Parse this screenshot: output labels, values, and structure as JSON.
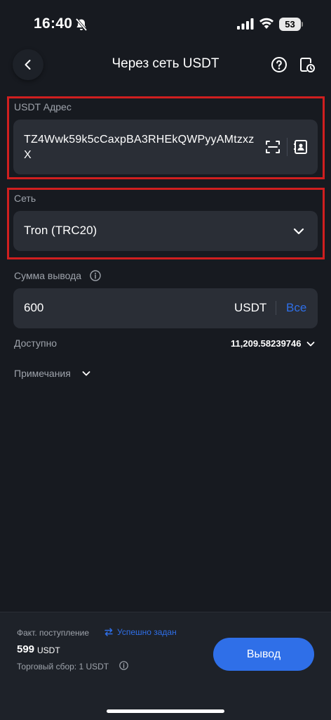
{
  "status_bar": {
    "time": "16:40",
    "battery": "53"
  },
  "header": {
    "title": "Через сеть USDT"
  },
  "address": {
    "label": "USDT Адрес",
    "value": "TZ4Wwk59k5cCaxpBA3RHEkQWPyyAMtzxzX"
  },
  "network": {
    "label": "Сеть",
    "value": "Tron (TRC20)"
  },
  "amount": {
    "label": "Сумма вывода",
    "value": "600",
    "unit": "USDT",
    "all_label": "Все"
  },
  "available": {
    "label": "Доступно",
    "value": "11,209.58239746"
  },
  "notes": {
    "label": "Примечания"
  },
  "footer": {
    "fact_label": "Факт. поступление",
    "success_label": "Успешно задан",
    "received_value": "599",
    "received_unit": "USDT",
    "fee_label": "Торговый сбор: 1 USDT",
    "submit_label": "Вывод"
  },
  "colors": {
    "accent": "#2f6fe8",
    "highlight": "#d01f1f",
    "background": "#171a20",
    "field": "#2a2e36"
  },
  "icons": [
    "bell-off-icon",
    "signal-icon",
    "wifi-icon",
    "battery-icon",
    "back-arrow-icon",
    "help-icon",
    "history-icon",
    "scan-icon",
    "contacts-icon",
    "chevron-down-icon",
    "info-icon",
    "swap-icon"
  ]
}
